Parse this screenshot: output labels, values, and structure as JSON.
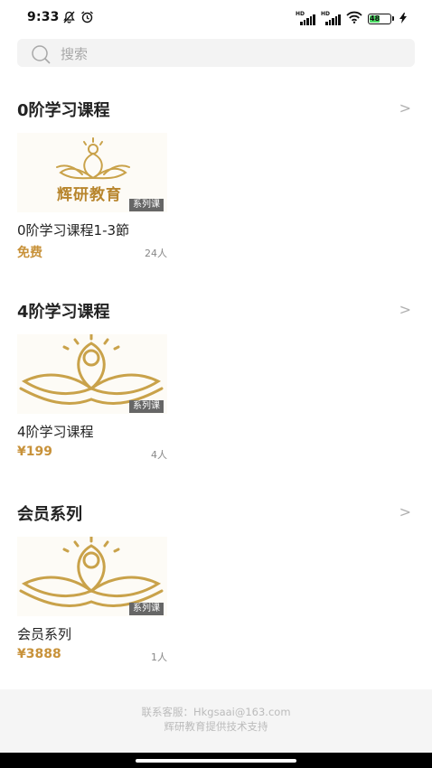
{
  "status_bar": {
    "time": "9:33",
    "battery": "48"
  },
  "search": {
    "placeholder": "搜索"
  },
  "sections": [
    {
      "title": "0阶学习课程",
      "course": {
        "thumb_text": "辉研教育",
        "tag": "系列课",
        "name": "0阶学习课程1-3節",
        "price": "免费",
        "count": "24人"
      }
    },
    {
      "title": "4阶学习课程",
      "course": {
        "tag": "系列课",
        "name": "4阶学习课程",
        "price": "¥199",
        "count": "4人"
      }
    },
    {
      "title": "会员系列",
      "course": {
        "tag": "系列课",
        "name": "会员系列",
        "price": "¥3888",
        "count": "1人"
      }
    }
  ],
  "footer": {
    "contact": "联系客服：Hkgsaai@163.com",
    "support": "辉研教育提供技术支持"
  },
  "colors": {
    "accent_gold": "#c8923a",
    "logo_gold": "#c9a24a"
  }
}
